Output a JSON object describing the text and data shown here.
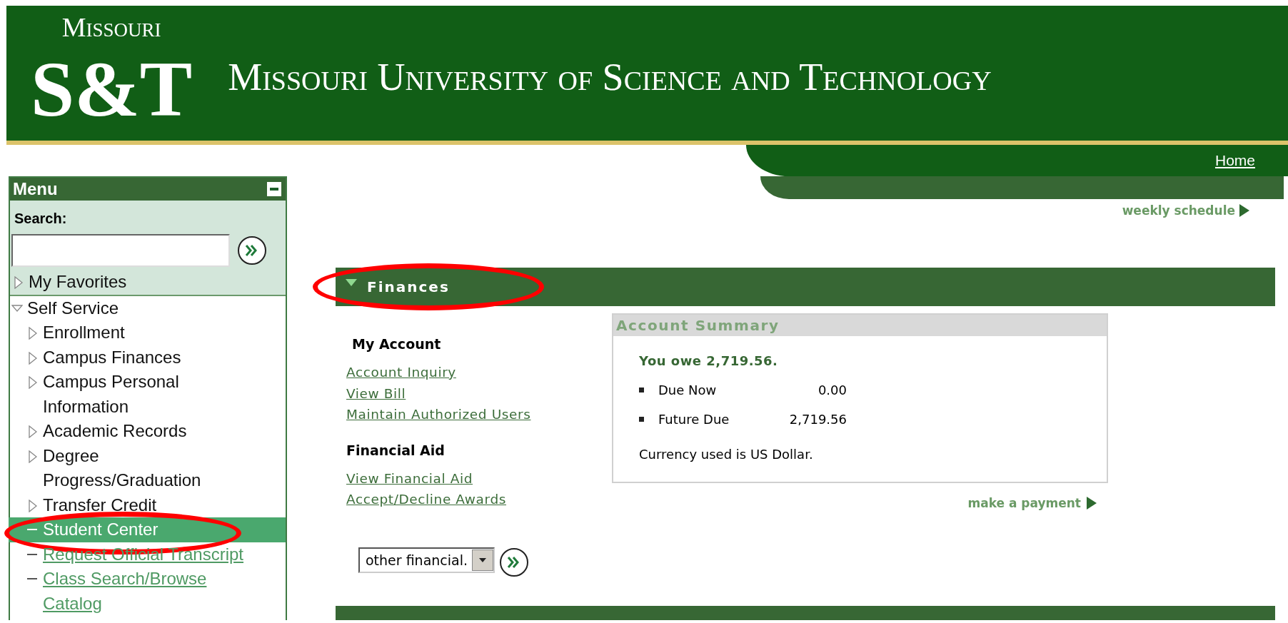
{
  "header": {
    "logo_top": "Missouri",
    "logo_main": "S&T",
    "title": "Missouri University of Science and Technology"
  },
  "nav": {
    "home": "Home",
    "weekly_schedule": "weekly schedule"
  },
  "menu": {
    "title": "Menu",
    "search_label": "Search:",
    "items": [
      {
        "label": "My Favorites",
        "kind": "folder",
        "expanded": false
      },
      {
        "label": "Self Service",
        "kind": "folder",
        "expanded": true,
        "children": [
          {
            "label": "Enrollment",
            "kind": "folder",
            "expanded": false
          },
          {
            "label": "Campus Finances",
            "kind": "folder",
            "expanded": false
          },
          {
            "label": "Campus Personal Information",
            "kind": "folder",
            "expanded": false
          },
          {
            "label": "Academic Records",
            "kind": "folder",
            "expanded": false
          },
          {
            "label": "Degree Progress/Graduation",
            "kind": "folder",
            "expanded": false
          },
          {
            "label": "Transfer Credit",
            "kind": "folder",
            "expanded": false
          },
          {
            "label": "Student Center",
            "kind": "link",
            "selected": true,
            "highlighted": true
          },
          {
            "label": "Request Official Transcript",
            "kind": "link",
            "selected": false,
            "highlighted": false
          },
          {
            "label": "Class Search/Browse Catalog",
            "kind": "link",
            "selected": false,
            "highlighted": false
          }
        ]
      }
    ]
  },
  "finances": {
    "title": "Finances",
    "expanded": true,
    "highlighted": true,
    "groups": [
      {
        "heading": "My Account",
        "links": [
          "Account Inquiry",
          "View Bill",
          "Maintain Authorized Users"
        ]
      },
      {
        "heading": "Financial Aid",
        "links": [
          "View Financial Aid",
          "Accept/Decline Awards"
        ]
      }
    ],
    "select": {
      "value": "other financial."
    },
    "summary": {
      "title": "Account Summary",
      "owe": "You owe 2,719.56.",
      "rows": [
        {
          "label": "Due Now",
          "amount": "0.00"
        },
        {
          "label": "Future Due",
          "amount": "2,719.56"
        }
      ],
      "currency": "Currency used is US Dollar."
    },
    "make_payment": "make a payment"
  }
}
